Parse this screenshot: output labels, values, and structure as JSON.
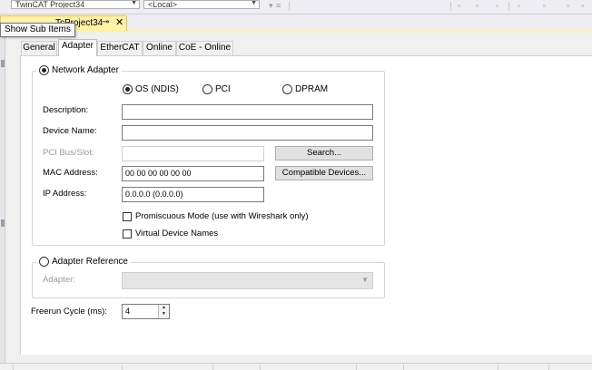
{
  "toolbar": {
    "project_combo": "TwinCAT Project34",
    "target_combo": "<Local>"
  },
  "document_tab": {
    "title": "TcProject34",
    "pin_glyph": "⊸",
    "close_glyph": "✕"
  },
  "tooltip": "Show Sub Items",
  "sub_tabs": [
    {
      "label": "General"
    },
    {
      "label": "Adapter"
    },
    {
      "label": "EtherCAT"
    },
    {
      "label": "Online"
    },
    {
      "label": "CoE - Online"
    }
  ],
  "network_adapter": {
    "title": "Network Adapter",
    "selected": true,
    "options": [
      {
        "label": "OS (NDIS)",
        "checked": true
      },
      {
        "label": "PCI",
        "checked": false
      },
      {
        "label": "DPRAM",
        "checked": false
      }
    ],
    "fields": {
      "description_label": "Description:",
      "description_value": "",
      "device_name_label": "Device Name:",
      "device_name_value": "",
      "pci_bus_label": "PCI Bus/Slot:",
      "pci_bus_value": "",
      "mac_label": "MAC Address:",
      "mac_value": "00 00 00 00 00 00",
      "ip_label": "IP Address:",
      "ip_value": "0.0.0.0 (0.0.0.0)"
    },
    "buttons": {
      "search": "Search...",
      "compatible": "Compatible Devices..."
    },
    "checks": {
      "promiscuous": "Promiscuous Mode (use with Wireshark only)",
      "virtual_names": "Virtual Device Names"
    }
  },
  "adapter_reference": {
    "title": "Adapter Reference",
    "selected": false,
    "adapter_label": "Adapter:",
    "adapter_value": ""
  },
  "freerun": {
    "label": "Freerun Cycle (ms):",
    "value": "4"
  },
  "colors": {
    "active_tab": "#fff1a8",
    "accent_border": "#e5c365"
  },
  "icons": {
    "dropdown": "chevron-down-icon",
    "spin_up": "triangle-up-icon",
    "spin_down": "triangle-down-icon"
  }
}
